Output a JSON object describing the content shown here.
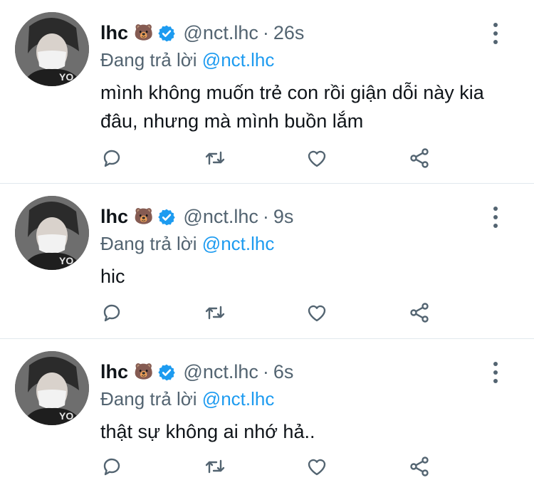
{
  "tweets": [
    {
      "name": "lhc",
      "emoji": "🐻",
      "handle": "@nct.lhc",
      "time": "26s",
      "reply_prefix": "Đang trả lời",
      "reply_to": "@nct.lhc",
      "text": "mình không muốn trẻ con rồi giận dỗi này kia đâu, nhưng mà mình buồn lắm"
    },
    {
      "name": "lhc",
      "emoji": "🐻",
      "handle": "@nct.lhc",
      "time": "9s",
      "reply_prefix": "Đang trả lời",
      "reply_to": "@nct.lhc",
      "text": "hic"
    },
    {
      "name": "lhc",
      "emoji": "🐻",
      "handle": "@nct.lhc",
      "time": "6s",
      "reply_prefix": "Đang trả lời",
      "reply_to": "@nct.lhc",
      "text": "thật sự không ai nhớ hả.."
    }
  ],
  "separator": "·",
  "colors": {
    "text": "#0f1419",
    "muted": "#536471",
    "link": "#1d9bf0",
    "verified": "#1d9bf0",
    "divider": "#e1e8ed"
  },
  "icons": [
    "reply-icon",
    "retweet-icon",
    "like-icon",
    "share-icon",
    "more-icon",
    "verified-icon"
  ]
}
